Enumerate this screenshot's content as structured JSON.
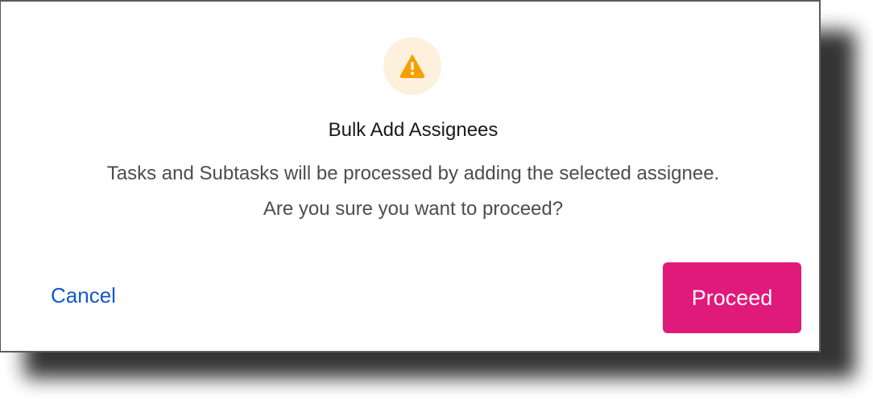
{
  "dialog": {
    "icon": "warning-triangle-icon",
    "title": "Bulk Add Assignees",
    "message_line1": "Tasks and Subtasks will be processed by adding the selected assignee.",
    "message_line2": "Are you sure you want to proceed?",
    "cancel_label": "Cancel",
    "proceed_label": "Proceed"
  },
  "colors": {
    "warning_icon": "#f5a000",
    "warning_bg": "#fdf1de",
    "primary_button": "#e01a7a",
    "link": "#1357c9"
  }
}
